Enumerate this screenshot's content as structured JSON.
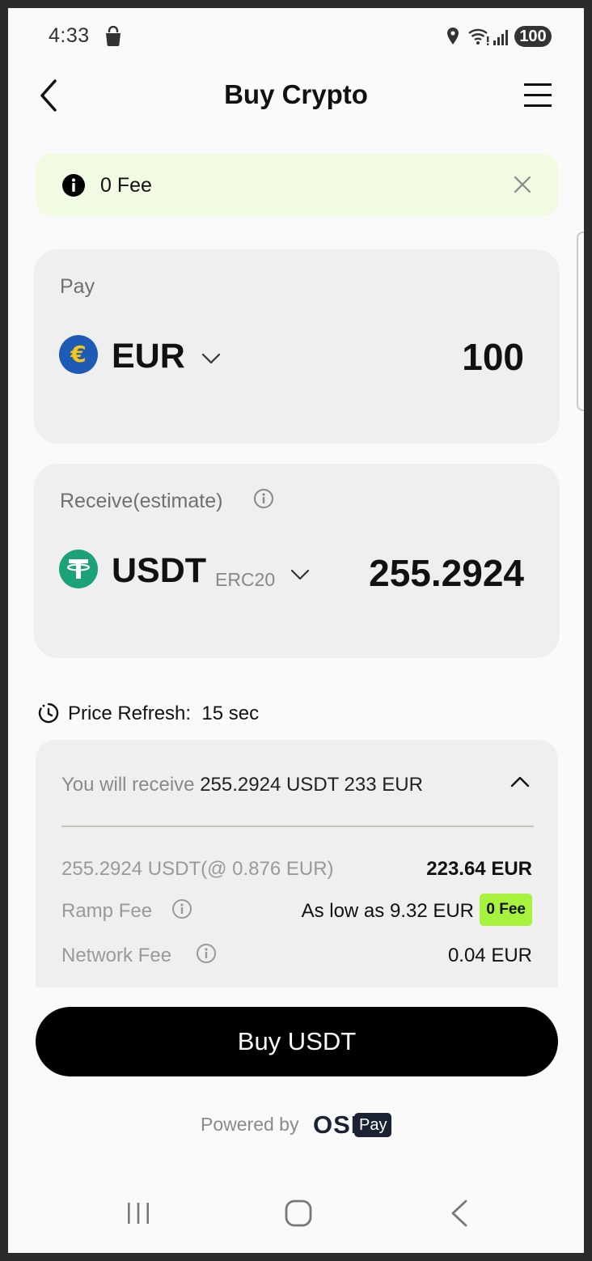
{
  "status_bar": {
    "time": "4:33",
    "battery": "100",
    "icons": [
      "shopping-bag-icon",
      "location-icon",
      "wifi-icon",
      "signal-icon"
    ]
  },
  "header": {
    "title": "Buy Crypto",
    "back_icon": "chevron-left-icon",
    "menu_icon": "hamburger-menu-icon"
  },
  "notice": {
    "text": "0 Fee",
    "icon": "info-icon",
    "close_icon": "close-icon",
    "background": "#f1fbe3"
  },
  "pay": {
    "label": "Pay",
    "currency": "EUR",
    "currency_icon": "euro-coin-icon",
    "amount": "100"
  },
  "receive": {
    "label": "Receive(estimate)",
    "currency": "USDT",
    "network": "ERC20",
    "currency_icon": "tether-icon",
    "amount": "255.2924"
  },
  "price_refresh": {
    "label": "Price Refresh:",
    "value": "15 sec"
  },
  "summary": {
    "prefix": "You will receive",
    "highlight": "255.2924 USDT 233 EUR",
    "rows": [
      {
        "label": "255.2924 USDT(@ 0.876 EUR)",
        "value": "223.64 EUR"
      },
      {
        "label": "Ramp Fee",
        "value": "As low as 9.32 EUR",
        "badge": "0 Fee"
      },
      {
        "label": "Network Fee",
        "value": "0.04 EUR"
      }
    ]
  },
  "buy_button": {
    "label": "Buy USDT"
  },
  "footer": {
    "powered_by": "Powered by",
    "brand": "OSL",
    "brand_suffix": "Pay"
  },
  "colors": {
    "accent": "#000000",
    "fee_badge": "#a6f23c",
    "euro_coin": "#1e5bb5",
    "tether": "#1ba27a",
    "card_bg": "#efefef"
  }
}
